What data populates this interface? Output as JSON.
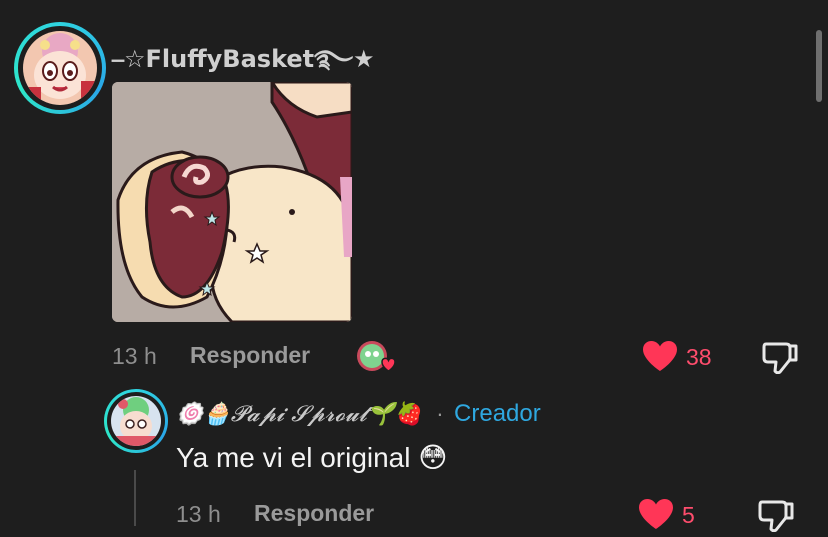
{
  "comment": {
    "username": "⎯☆FluffyBasket࿐★",
    "time": "13 h",
    "reply_label": "Responder",
    "likes": "38"
  },
  "reply": {
    "username": "🍥🧁𝓟𝓪𝓹𝓲 𝓢𝓹𝓻𝓸𝓾𝓽🌱🍓",
    "separator": "·",
    "creator_label": "Creador",
    "text": "Ya me vi el original 😳",
    "time": "13 h",
    "reply_label": "Responder",
    "likes": "5"
  },
  "colors": {
    "background": "#1e1e1e",
    "like": "#ff4d6d",
    "creator": "#2fa8e0",
    "avatar_ring": "#2fd3e0"
  },
  "icons": {
    "like": "heart-icon",
    "dislike": "thumbs-down-icon",
    "creator_liked": "creator-heart-badge-icon"
  }
}
